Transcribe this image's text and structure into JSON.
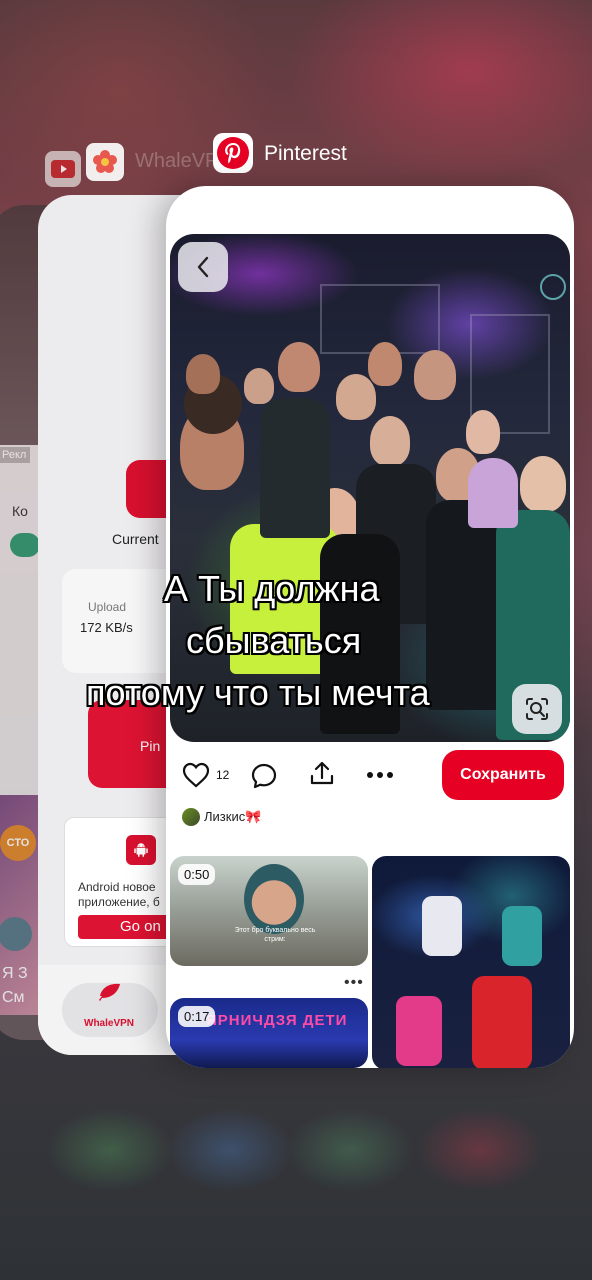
{
  "app_switcher": {
    "apps": [
      {
        "name": "",
        "icon": "youtube-icon"
      },
      {
        "name": "",
        "icon": "flower-icon"
      },
      {
        "name": "WhaleVPN",
        "icon": "whalevpn-icon"
      },
      {
        "name": "Pinterest",
        "icon": "pinterest-icon"
      }
    ]
  },
  "far_card": {
    "ad_tag": "Рекл",
    "ad_text": "Ко",
    "badge": "СТО",
    "text_line1": "Я З",
    "text_line2": "См"
  },
  "whalevpn": {
    "current_label": "Current",
    "upload_label": "Upload",
    "upload_value": "172 KB/s",
    "button_label": "Pin",
    "info_line1": "Android новое",
    "info_line2": "приложение, б",
    "go_button": "Go on",
    "tab_label": "WhaleVPN"
  },
  "pinterest": {
    "lyrics": [
      "А Ты должна",
      "сбываться",
      "потому что ты мечта"
    ],
    "like_count": "12",
    "save_label": "Сохранить",
    "author_name": "Лизкис🎀",
    "thumb1_duration": "0:50",
    "thumb1_caption": "Этот бро буквально весь стрим:",
    "thumb3_duration": "0:17",
    "thumb3_neon": "ЯРНИЧДЗЯ ДЕТИ",
    "more": "•••"
  },
  "colors": {
    "pinterest_red": "#e60023",
    "whalevpn_red": "#d8102f"
  }
}
